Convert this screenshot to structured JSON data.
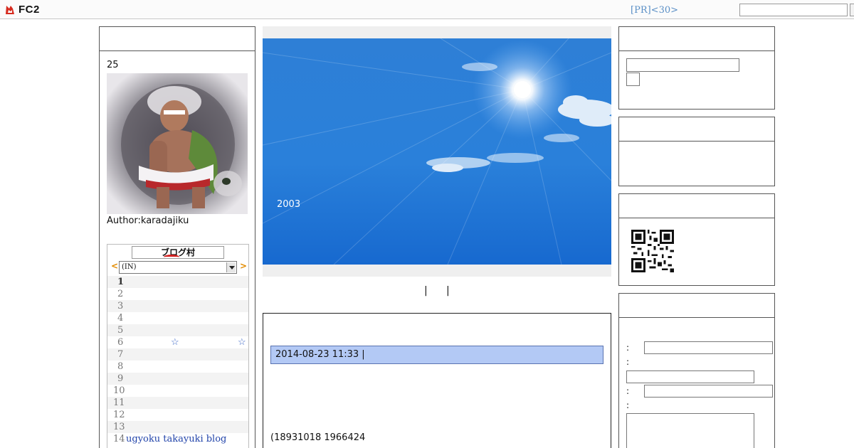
{
  "topbar": {
    "logo_text": "FC2",
    "pr_link": "[PR]<30>"
  },
  "profile": {
    "number": "25",
    "author": "Author:karadajiku"
  },
  "ranking": {
    "logo_text": "ブログ村",
    "prev_arrow": "<",
    "next_arrow": ">",
    "select_value": "(IN)",
    "rows": [
      {
        "n": "1",
        "name": ""
      },
      {
        "n": "2",
        "name": ""
      },
      {
        "n": "3",
        "name": ""
      },
      {
        "n": "4",
        "name": ""
      },
      {
        "n": "5",
        "name": ""
      },
      {
        "n": "6",
        "name": ""
      },
      {
        "n": "7",
        "name": ""
      },
      {
        "n": "8",
        "name": ""
      },
      {
        "n": "9",
        "name": ""
      },
      {
        "n": "10",
        "name": ""
      },
      {
        "n": "11",
        "name": ""
      },
      {
        "n": "12",
        "name": ""
      },
      {
        "n": "13",
        "name": ""
      },
      {
        "n": "14",
        "name": "ugyoku takayuki blog"
      }
    ],
    "row6_star_a": "☆",
    "row6_star_b": "☆"
  },
  "header": {
    "year": "2003"
  },
  "nav": {
    "sep1": "|",
    "sep2": "|"
  },
  "entry": {
    "date": "2014-08-23 11:33 |",
    "text": "(18931018  1966424"
  },
  "right": {
    "colon": ":"
  },
  "colors": {
    "sky_top": "#2f7fd6",
    "sky_bottom": "#1a6bd0",
    "date_bg": "#b3c9f5",
    "link": "#2244aa"
  }
}
